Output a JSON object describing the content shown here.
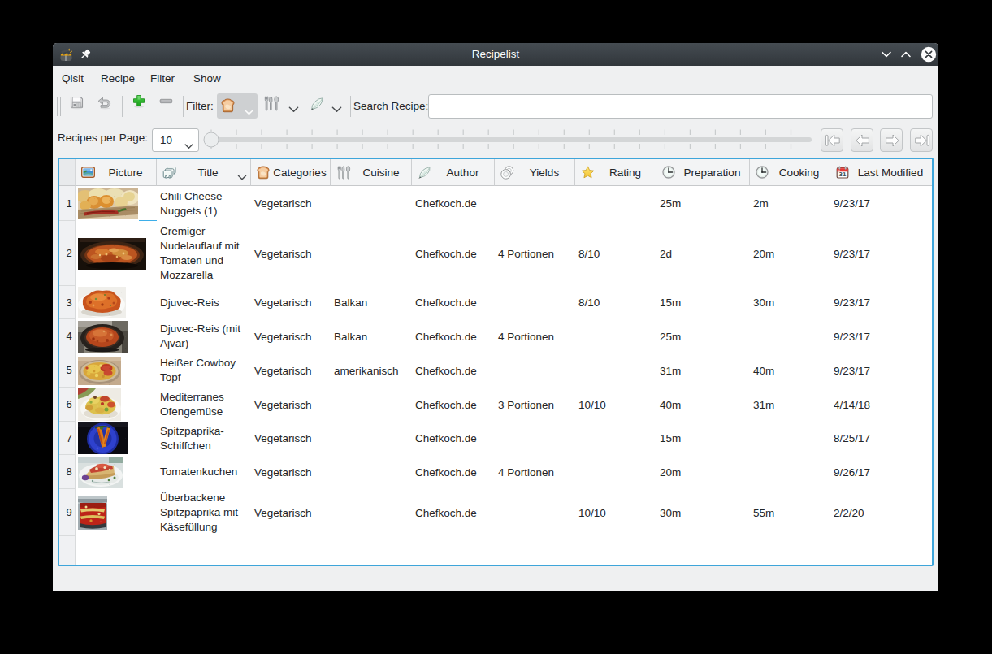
{
  "window": {
    "title": "Recipelist"
  },
  "menu": {
    "items": [
      "Qisit",
      "Recipe",
      "Filter",
      "Show"
    ]
  },
  "toolbar": {
    "filter_label": "Filter:",
    "search_label": "Search Recipe:",
    "search_value": "",
    "buttons": [
      "save",
      "undo",
      "add",
      "remove",
      "filter-categories",
      "filter-cuisine",
      "filter-author"
    ]
  },
  "pagination": {
    "label": "Recipes per Page:",
    "per_page": "10",
    "nav": [
      "first-page",
      "previous-page",
      "next-page",
      "last-page"
    ]
  },
  "table": {
    "columns": [
      {
        "label": "Picture",
        "icon": "picture-icon"
      },
      {
        "label": "Title",
        "icon": "title-cards-icon",
        "sorted": "asc"
      },
      {
        "label": "Categories",
        "icon": "bread-icon"
      },
      {
        "label": "Cuisine",
        "icon": "cutlery-icon"
      },
      {
        "label": "Author",
        "icon": "feather-icon"
      },
      {
        "label": "Yields",
        "icon": "plates-icon"
      },
      {
        "label": "Rating",
        "icon": "star-icon"
      },
      {
        "label": "Preparation",
        "icon": "clock-icon"
      },
      {
        "label": "Cooking",
        "icon": "clock-icon"
      },
      {
        "label": "Last Modified",
        "icon": "calendar-icon"
      }
    ],
    "rows": [
      {
        "num": "1",
        "title": "Chili Cheese Nuggets (1)",
        "categories": "Vegetarisch",
        "cuisine": "",
        "author": "Chefkoch.de",
        "yields": "",
        "rating": "",
        "preparation": "25m",
        "cooking": "2m",
        "last_modified": "9/23/17"
      },
      {
        "num": "2",
        "title": "Cremiger Nudelauflauf mit Tomaten und Mozzarella",
        "categories": "Vegetarisch",
        "cuisine": "",
        "author": "Chefkoch.de",
        "yields": "4 Portionen",
        "rating": "8/10",
        "preparation": "2d",
        "cooking": "20m",
        "last_modified": "9/23/17"
      },
      {
        "num": "3",
        "title": "Djuvec-Reis",
        "categories": "Vegetarisch",
        "cuisine": "Balkan",
        "author": "Chefkoch.de",
        "yields": "",
        "rating": "8/10",
        "preparation": "15m",
        "cooking": "30m",
        "last_modified": "9/23/17"
      },
      {
        "num": "4",
        "title": "Djuvec-Reis (mit Ajvar)",
        "categories": "Vegetarisch",
        "cuisine": "Balkan",
        "author": "Chefkoch.de",
        "yields": "4 Portionen",
        "rating": "",
        "preparation": "25m",
        "cooking": "",
        "last_modified": "9/23/17"
      },
      {
        "num": "5",
        "title": "Heißer Cowboy Topf",
        "categories": "Vegetarisch",
        "cuisine": "amerikanisch",
        "author": "Chefkoch.de",
        "yields": "",
        "rating": "",
        "preparation": "31m",
        "cooking": "40m",
        "last_modified": "9/23/17"
      },
      {
        "num": "6",
        "title": "Mediterranes Ofengemüse",
        "categories": "Vegetarisch",
        "cuisine": "",
        "author": "Chefkoch.de",
        "yields": "3 Portionen",
        "rating": "10/10",
        "preparation": "40m",
        "cooking": "31m",
        "last_modified": "4/14/18"
      },
      {
        "num": "7",
        "title": "Spitzpaprika-Schiffchen",
        "categories": "Vegetarisch",
        "cuisine": "",
        "author": "Chefkoch.de",
        "yields": "",
        "rating": "",
        "preparation": "15m",
        "cooking": "",
        "last_modified": "8/25/17"
      },
      {
        "num": "8",
        "title": "Tomatenkuchen",
        "categories": "Vegetarisch",
        "cuisine": "",
        "author": "Chefkoch.de",
        "yields": "4 Portionen",
        "rating": "",
        "preparation": "20m",
        "cooking": "",
        "last_modified": "9/26/17"
      },
      {
        "num": "9",
        "title": "Überbackene Spitzpaprika mit Käsefüllung",
        "categories": "Vegetarisch",
        "cuisine": "",
        "author": "Chefkoch.de",
        "yields": "",
        "rating": "10/10",
        "preparation": "30m",
        "cooking": "55m",
        "last_modified": "2/2/20"
      }
    ]
  },
  "colors": {
    "accent_blue": "#3daee9",
    "titlebar": "#31363b",
    "window_bg": "#eff0f1",
    "text": "#232629",
    "add_green": "#27ae60"
  }
}
